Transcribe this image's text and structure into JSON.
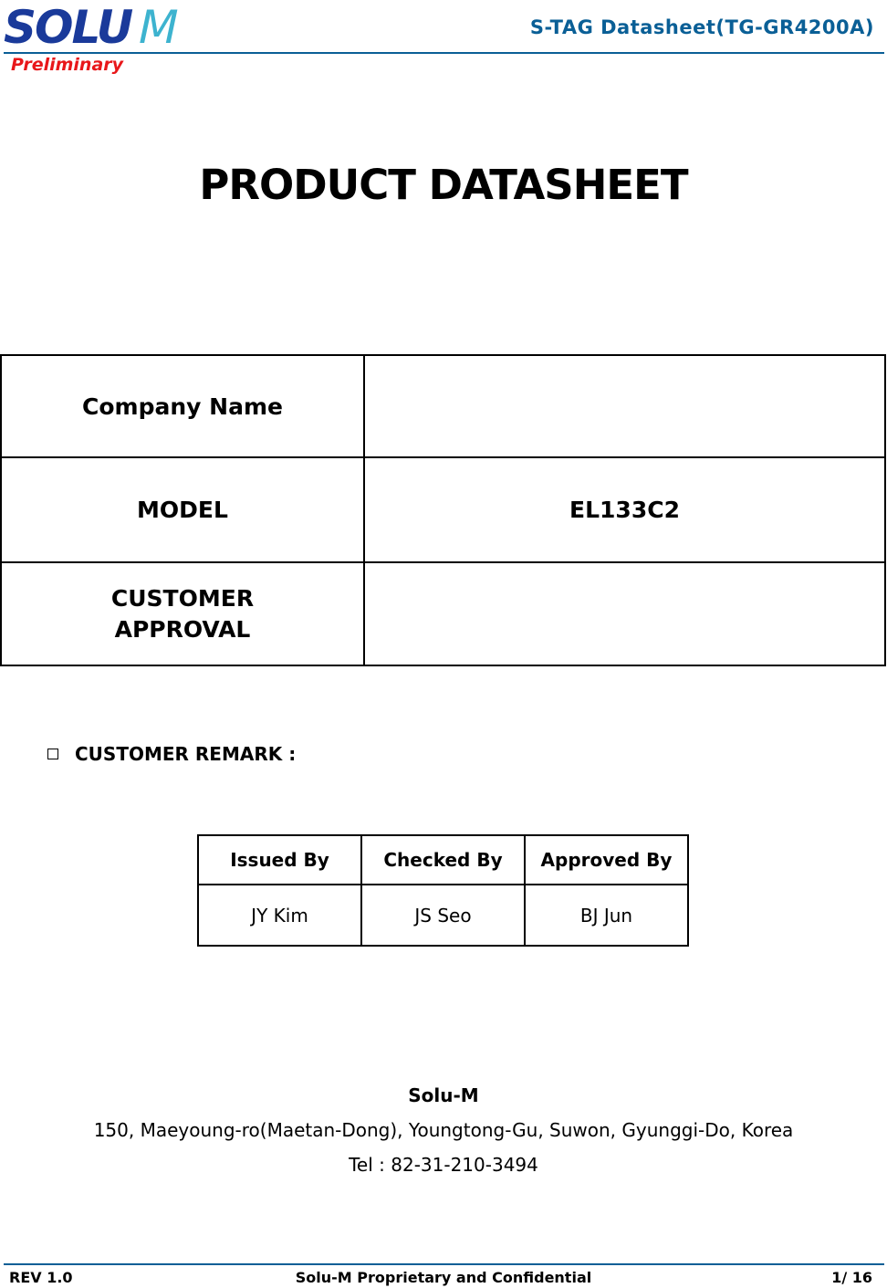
{
  "header": {
    "logo_solu": "SOLU",
    "logo_m": "M",
    "title": "S-TAG Datasheet(TG-GR4200A)",
    "status": "Preliminary",
    "accent_color": "#0a5f96",
    "status_color": "#e8171a"
  },
  "document": {
    "title": "PRODUCT DATASHEET"
  },
  "info_table": {
    "rows": [
      {
        "label": "Company Name",
        "value": ""
      },
      {
        "label": "MODEL",
        "value": "EL133C2"
      },
      {
        "label_line1": "CUSTOMER",
        "label_line2": "APPROVAL",
        "value": ""
      }
    ]
  },
  "remark": {
    "label": "CUSTOMER REMARK :"
  },
  "sign_table": {
    "headers": [
      "Issued By",
      "Checked By",
      "Approved By"
    ],
    "values": [
      "JY Kim",
      "JS Seo",
      "BJ Jun"
    ]
  },
  "contact": {
    "company": "Solu-M",
    "address": "150, Maeyoung-ro(Maetan-Dong), Youngtong-Gu, Suwon, Gyunggi-Do, Korea",
    "tel": "Tel : 82-31-210-3494"
  },
  "footer": {
    "revision": "REV 1.0",
    "confidentiality": "Solu-M Proprietary and Confidential",
    "page": "1/ 16"
  }
}
